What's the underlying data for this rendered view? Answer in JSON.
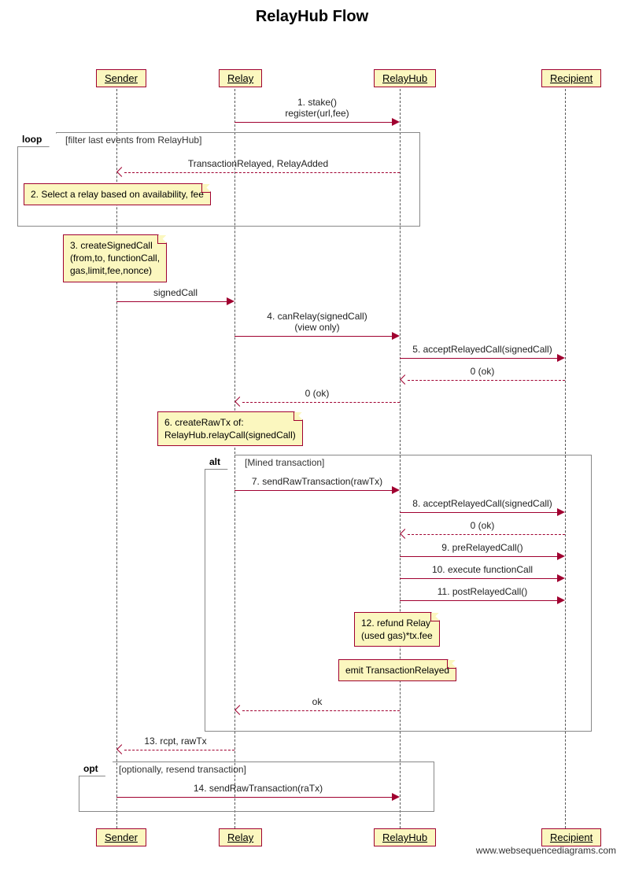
{
  "title": "RelayHub Flow",
  "actors": {
    "sender": "Sender",
    "relay": "Relay",
    "relayhub": "RelayHub",
    "recipient": "Recipient"
  },
  "messages": {
    "m1l1": "1. stake()",
    "m1l2": "register(url,fee)",
    "m2": "TransactionRelayed, RelayAdded",
    "m3": "signedCall",
    "m4l1": "4. canRelay(signedCall)",
    "m4l2": "(view only)",
    "m5": "5. acceptRelayedCall(signedCall)",
    "m6": "0 (ok)",
    "m7": "0 (ok)",
    "m8": "7. sendRawTransaction(rawTx)",
    "m9": "8. acceptRelayedCall(signedCall)",
    "m10": "0 (ok)",
    "m11": "9. preRelayedCall()",
    "m12": "10. execute functionCall",
    "m13": "11. postRelayedCall()",
    "m14": "ok",
    "m15": "13. rcpt, rawTx",
    "m16": "14. sendRawTransaction(raTx)"
  },
  "notes": {
    "n2": "2. Select a relay based on availability, fee",
    "n3": "3. createSignedCall\n(from,to, functionCall,\ngas,limit,fee,nonce)",
    "n6": "6. createRawTx of:\nRelayHub.relayCall(signedCall)",
    "n12": "12. refund Relay\n(used gas)*tx.fee",
    "nemit": "emit TransactionRelayed"
  },
  "frames": {
    "loop": {
      "label": "loop",
      "cond": "[filter last events from RelayHub]"
    },
    "alt": {
      "label": "alt",
      "cond": "[Mined transaction]"
    },
    "opt": {
      "label": "opt",
      "cond": "[optionally, resend transaction]"
    }
  },
  "footer": "www.websequencediagrams.com",
  "chart_data": {
    "type": "sequence",
    "title": "RelayHub Flow",
    "participants": [
      "Sender",
      "Relay",
      "RelayHub",
      "Recipient"
    ],
    "steps": [
      {
        "from": "Relay",
        "to": "RelayHub",
        "text": "1. stake() register(url,fee)",
        "style": "solid"
      },
      {
        "frame": "loop",
        "cond": "filter last events from RelayHub",
        "contains": [
          {
            "from": "RelayHub",
            "to": "Sender",
            "text": "TransactionRelayed, RelayAdded",
            "style": "dashed"
          },
          {
            "note_over": "Sender",
            "text": "2. Select a relay based on availability, fee"
          }
        ]
      },
      {
        "note_over": "Sender",
        "text": "3. createSignedCall (from,to, functionCall, gas,limit,fee,nonce)"
      },
      {
        "from": "Sender",
        "to": "Relay",
        "text": "signedCall",
        "style": "solid"
      },
      {
        "from": "Relay",
        "to": "RelayHub",
        "text": "4. canRelay(signedCall) (view only)",
        "style": "solid"
      },
      {
        "from": "RelayHub",
        "to": "Recipient",
        "text": "5. acceptRelayedCall(signedCall)",
        "style": "solid"
      },
      {
        "from": "Recipient",
        "to": "RelayHub",
        "text": "0 (ok)",
        "style": "dashed"
      },
      {
        "from": "RelayHub",
        "to": "Relay",
        "text": "0 (ok)",
        "style": "dashed"
      },
      {
        "note_over": "Relay",
        "text": "6. createRawTx of: RelayHub.relayCall(signedCall)"
      },
      {
        "frame": "alt",
        "cond": "Mined transaction",
        "contains": [
          {
            "from": "Relay",
            "to": "RelayHub",
            "text": "7. sendRawTransaction(rawTx)",
            "style": "solid"
          },
          {
            "from": "RelayHub",
            "to": "Recipient",
            "text": "8. acceptRelayedCall(signedCall)",
            "style": "solid"
          },
          {
            "from": "Recipient",
            "to": "RelayHub",
            "text": "0 (ok)",
            "style": "dashed"
          },
          {
            "from": "RelayHub",
            "to": "Recipient",
            "text": "9. preRelayedCall()",
            "style": "solid"
          },
          {
            "from": "RelayHub",
            "to": "Recipient",
            "text": "10. execute functionCall",
            "style": "solid"
          },
          {
            "from": "RelayHub",
            "to": "Recipient",
            "text": "11. postRelayedCall()",
            "style": "solid"
          },
          {
            "note_over": "RelayHub",
            "text": "12. refund Relay (used gas)*tx.fee"
          },
          {
            "note_over": "RelayHub",
            "text": "emit TransactionRelayed"
          },
          {
            "from": "RelayHub",
            "to": "Relay",
            "text": "ok",
            "style": "dashed"
          }
        ]
      },
      {
        "from": "Relay",
        "to": "Sender",
        "text": "13. rcpt, rawTx",
        "style": "dashed"
      },
      {
        "frame": "opt",
        "cond": "optionally, resend transaction",
        "contains": [
          {
            "from": "Sender",
            "to": "RelayHub",
            "text": "14. sendRawTransaction(raTx)",
            "style": "solid"
          }
        ]
      }
    ]
  }
}
